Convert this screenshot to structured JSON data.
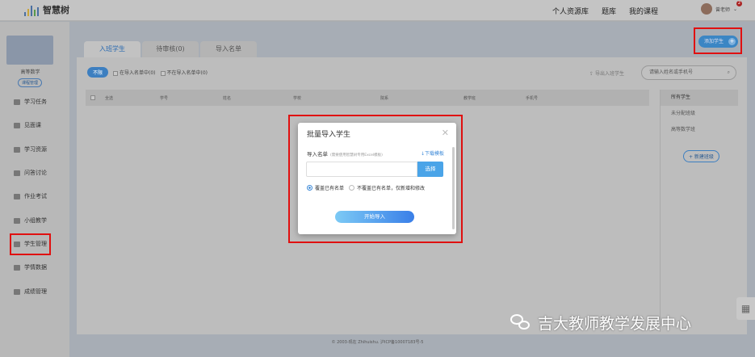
{
  "header": {
    "logo": "智慧树",
    "nav": [
      "个人资源库",
      "题库",
      "我的课程"
    ],
    "user_name": "曾老师",
    "badge": "2"
  },
  "sidebar": {
    "course_name": "高等数学",
    "course_mgmt": "课程管理",
    "items": [
      {
        "label": "学习任务"
      },
      {
        "label": "见面课"
      },
      {
        "label": "学习资源"
      },
      {
        "label": "问答讨论"
      },
      {
        "label": "作业考试"
      },
      {
        "label": "小组教学"
      },
      {
        "label": "学生管理"
      },
      {
        "label": "学情数据"
      },
      {
        "label": "成绩管理"
      }
    ]
  },
  "tabs": [
    "入班学生",
    "待审核(0)",
    "导入名单"
  ],
  "add_student": "添加学生",
  "filter": {
    "all": "不限",
    "in_list": "在导入名单中(0)",
    "not_in_list": "不在导入名单中(0)"
  },
  "export": "导出入班学生",
  "search_placeholder": "请输入姓名或手机号",
  "table_headers": [
    "全选",
    "学号",
    "姓名",
    "学校",
    "院系",
    "教学班",
    "手机号"
  ],
  "classes": [
    "所有学生",
    "未分配班级",
    "高等数学班"
  ],
  "new_class": "+ 新建班级",
  "footer": "© 2003-现在 Zhihuishu. 沪ICP备10007183号-5",
  "modal": {
    "title": "批量导入学生",
    "label": "导入名单",
    "hint": "(需要使用智慧树专用Excel模板)",
    "download": "下载模板",
    "choose": "选择",
    "opt1": "覆盖已有名单",
    "opt2": "不覆盖已有名单，仅新增和修改",
    "start": "开始导入"
  },
  "watermark": "吉大教师教学发展中心"
}
